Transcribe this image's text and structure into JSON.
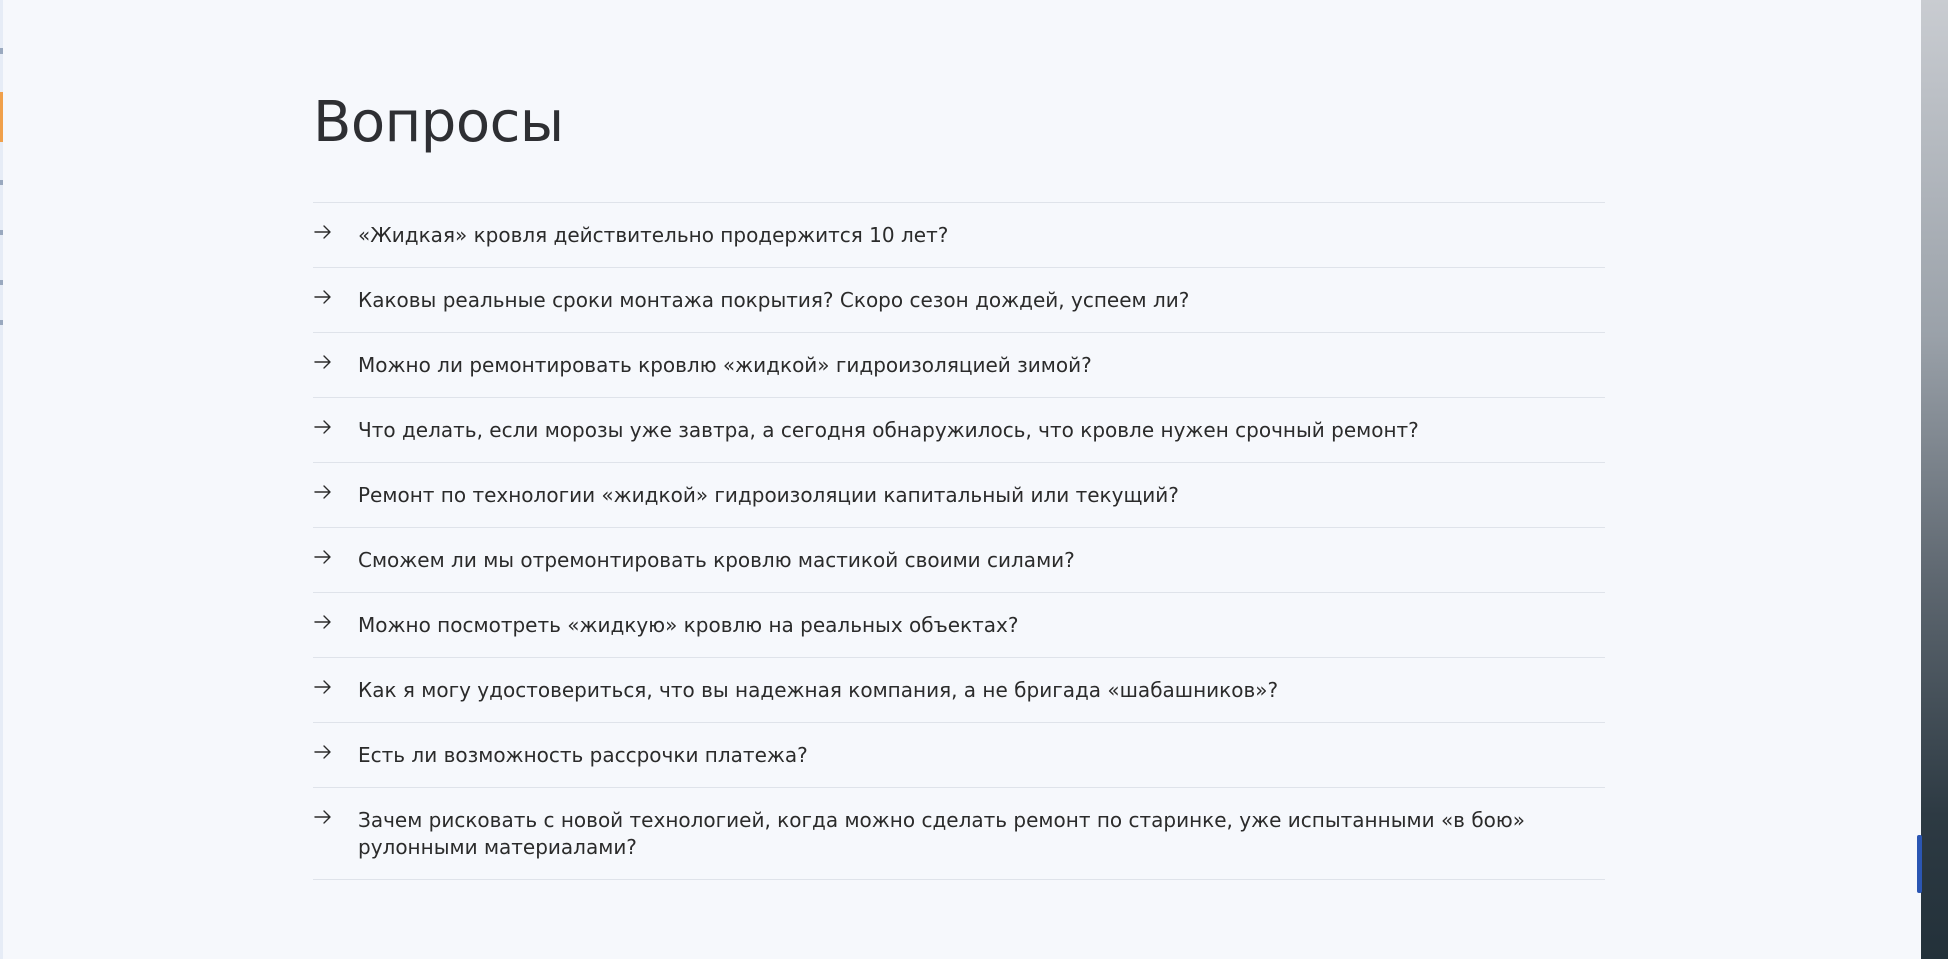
{
  "section": {
    "title": "Вопросы"
  },
  "faq": [
    {
      "question": "«Жидкая» кровля действительно продержится 10 лет?"
    },
    {
      "question": "Каковы реальные сроки монтажа покрытия? Скоро сезон дождей, успеем ли?"
    },
    {
      "question": "Можно ли ремонтировать кровлю «жидкой» гидроизоляцией зимой?"
    },
    {
      "question": "Что делать, если морозы уже завтра, а сегодня обнаружилось, что кровле нужен срочный ремонт?"
    },
    {
      "question": "Ремонт по технологии «жидкой» гидроизоляции капитальный или текущий?"
    },
    {
      "question": "Сможем ли мы отремонтировать кровлю мастикой своими силами?"
    },
    {
      "question": "Можно посмотреть «жидкую» кровлю на реальных объектах?"
    },
    {
      "question": "Как я могу удостовериться, что вы надежная компания, а не бригада «шабашников»?"
    },
    {
      "question": "Есть ли возможность рассрочки платежа?"
    },
    {
      "question": "Зачем рисковать с новой технологией, когда можно сделать ремонт по старинке, уже испытанными «в бою» рулонными материалами?"
    }
  ],
  "icons": {
    "item_icon": "arrow-right-icon"
  },
  "colors": {
    "background": "#f6f8fc",
    "text": "#2b2b2b",
    "divider": "#dfe3ea",
    "scroll_accent": "#2b56b3",
    "left_accent": "#f0a04b"
  }
}
